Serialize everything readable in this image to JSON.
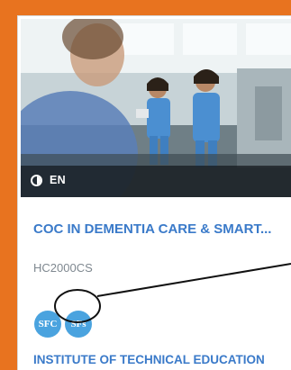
{
  "course": {
    "language": "EN",
    "title": "COC IN DEMENTIA CARE & SMART...",
    "code": "HC2000CS",
    "badges": [
      "SFC",
      "SFs"
    ],
    "provider": "INSTITUTE OF TECHNICAL EDUCATION"
  },
  "colors": {
    "frame": "#e8731f",
    "title": "#3a7ac9",
    "badge": "#4aa3df"
  },
  "icons": {
    "language": "contrast-half-circle-icon"
  }
}
